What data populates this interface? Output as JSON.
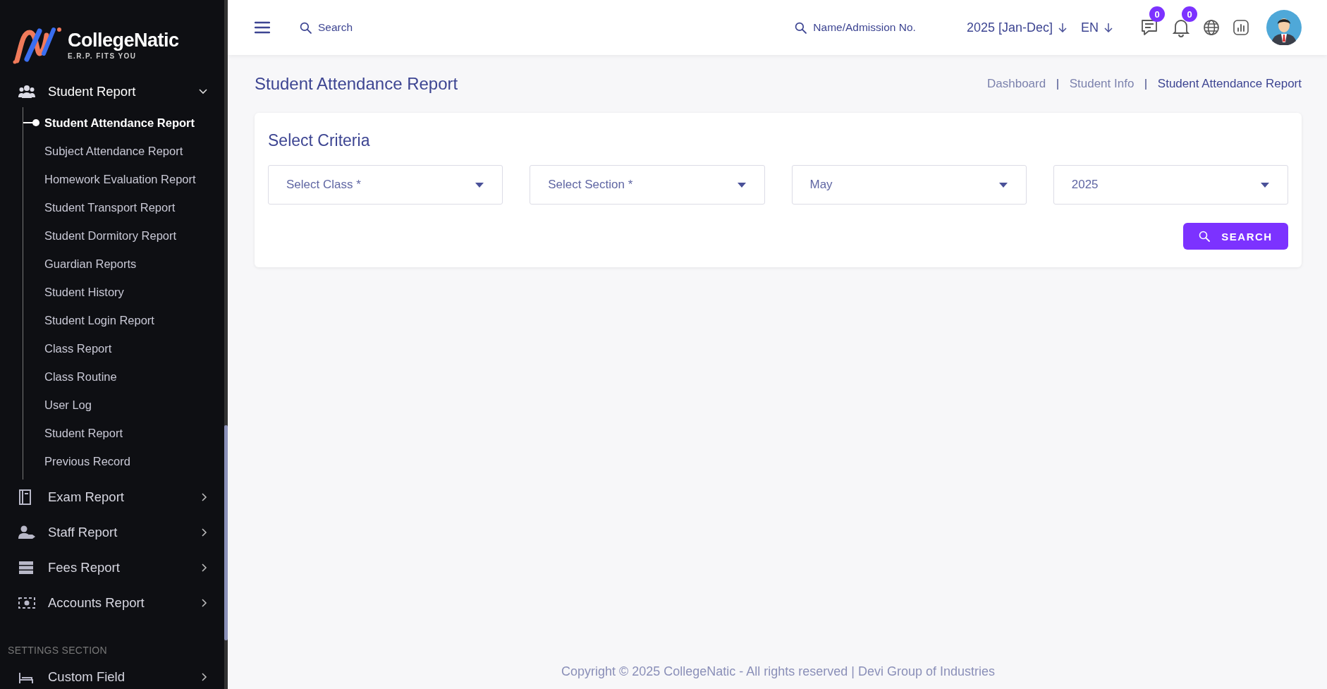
{
  "logo": {
    "name": "CollegeNatic",
    "tagline": "E.R.P. FITS YOU"
  },
  "sidebar": {
    "groups": [
      {
        "label": "Student Report",
        "expanded": true,
        "children": [
          {
            "label": "Student Attendance Report",
            "selected": true
          },
          {
            "label": "Subject Attendance Report",
            "selected": false
          },
          {
            "label": "Homework Evaluation Report",
            "selected": false
          },
          {
            "label": "Student Transport Report",
            "selected": false
          },
          {
            "label": "Student Dormitory Report",
            "selected": false
          },
          {
            "label": "Guardian Reports",
            "selected": false
          },
          {
            "label": "Student History",
            "selected": false
          },
          {
            "label": "Student Login Report",
            "selected": false
          },
          {
            "label": "Class Report",
            "selected": false
          },
          {
            "label": "Class Routine",
            "selected": false
          },
          {
            "label": "User Log",
            "selected": false
          },
          {
            "label": "Student Report",
            "selected": false
          },
          {
            "label": "Previous Record",
            "selected": false
          }
        ]
      },
      {
        "label": "Exam Report",
        "expanded": false
      },
      {
        "label": "Staff Report",
        "expanded": false
      },
      {
        "label": "Fees Report",
        "expanded": false
      },
      {
        "label": "Accounts Report",
        "expanded": false
      }
    ],
    "section_title": "SETTINGS SECTION",
    "settings_items": [
      {
        "label": "Custom Field",
        "expanded": false
      }
    ]
  },
  "header": {
    "search": {
      "placeholder": "Search"
    },
    "student_search": {
      "placeholder": "Name/Admission No."
    },
    "session": "2025 [Jan-Dec]",
    "language": "EN",
    "messages_count": "0",
    "notifications_count": "0"
  },
  "page": {
    "title": "Student Attendance Report",
    "breadcrumbs": [
      {
        "label": "Dashboard",
        "selected": false
      },
      {
        "label": "Student Info",
        "selected": false
      },
      {
        "label": "Student Attendance Report",
        "selected": true
      }
    ],
    "card_title": "Select Criteria",
    "selects": [
      {
        "placeholder": "Select Class *"
      },
      {
        "placeholder": "Select Section *"
      },
      {
        "value": "May"
      },
      {
        "value": "2025"
      }
    ],
    "button": "SEARCH"
  },
  "footer": "Copyright © 2025 CollegeNatic - All rights reserved | Devi Group of Industries"
}
